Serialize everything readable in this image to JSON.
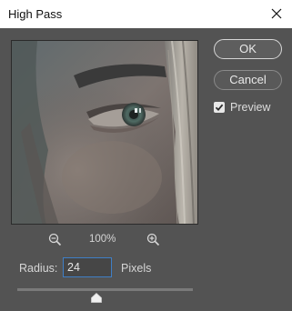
{
  "dialog": {
    "title": "High Pass",
    "ok_label": "OK",
    "cancel_label": "Cancel",
    "preview_label": "Preview",
    "preview_checked": true
  },
  "zoom": {
    "level": "100%"
  },
  "radius": {
    "label": "Radius:",
    "value": "24",
    "unit": "Pixels",
    "slider_fraction": 0.45
  },
  "icons": {
    "close": "close-icon",
    "zoom_out": "zoom-out-icon",
    "zoom_in": "zoom-in-icon",
    "check": "checkmark-icon"
  },
  "colors": {
    "background": "#535353",
    "accent": "#3f7fc6"
  }
}
